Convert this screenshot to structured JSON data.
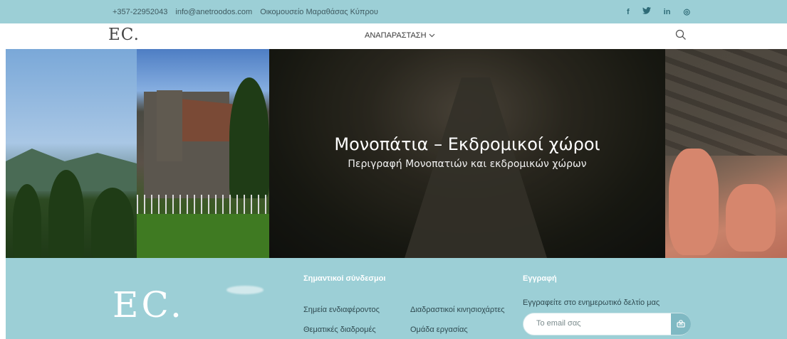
{
  "topbar": {
    "phone": "+357-22952043",
    "email": "info@anetroodos.com",
    "location": "Οικομουσείο Μαραθάσας Κύπρου",
    "social": [
      {
        "name": "facebook-icon",
        "glyph": "f"
      },
      {
        "name": "twitter-icon",
        "glyph": "🐦"
      },
      {
        "name": "linkedin-icon",
        "glyph": "in"
      },
      {
        "name": "instagram-icon",
        "glyph": "◎"
      }
    ]
  },
  "header": {
    "logo": "EC.",
    "menu_label": "ΑΝΑΠΑΡΑΣΤΑΣΗ",
    "search_icon": "search-icon"
  },
  "hero": {
    "title": "Μονοπάτια – Εκδρομικοί χώροι",
    "subtitle": "Περιγραφή Μονοπατιών και εκδρομικών χώρων"
  },
  "footer": {
    "logo": "EC.",
    "links_heading": "Σημαντικοί σύνδεσμοι",
    "links": [
      "Σημεία ενδιαφέροντος",
      "Διαδραστικοί κινησιοχάρτες",
      "Θεματικές διαδρομές",
      "Ομάδα εργασίας"
    ],
    "signup_heading": "Εγγραφή",
    "signup_text": "Εγγραφείτε στο ενημερωτικό δελτίο μας",
    "email_placeholder": "Το email σας",
    "send_icon": "send-icon"
  },
  "colors": {
    "accent": "#9ccfd6",
    "footer_text": "#2f4a50",
    "header_text": "#3a3a3a"
  }
}
